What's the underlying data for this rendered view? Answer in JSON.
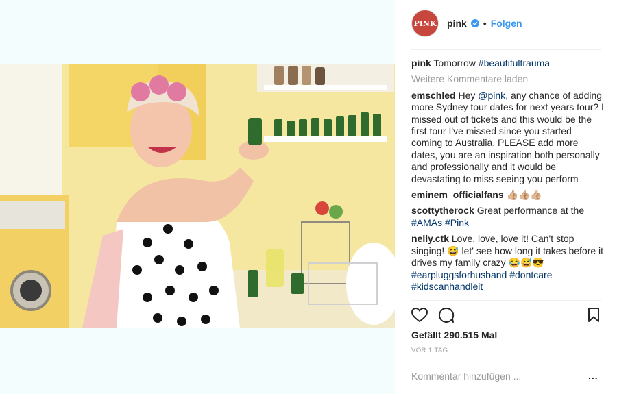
{
  "post": {
    "username": "pink",
    "avatar_text": "PINK",
    "follow_label": "Folgen",
    "separator": "•",
    "caption": {
      "user": "pink",
      "text": "Tomorrow",
      "hashtag": "#beautifultrauma"
    },
    "load_more": "Weitere Kommentare laden",
    "comments": [
      {
        "user": "emschled",
        "pre": "Hey",
        "mention": "@pink",
        "text": ", any chance of adding more Sydney tour dates for next years tour? I missed out of tickets and this would be the first tour I've missed since you started coming to Australia. PLEASE add more dates, you are an inspiration both personally and professionally and it would be devastating to miss seeing you perform"
      },
      {
        "user": "eminem_officialfans",
        "text": "👍🏼👍🏼👍🏼"
      },
      {
        "user": "scottytherock",
        "text": "Great performance at the",
        "hashtags": "#AMAs #Pink"
      },
      {
        "user": "nelly.ctk",
        "text": "Love, love, love it! Can't stop singing! 😅 let' see how long it takes before it drives my family crazy 😂😅😎",
        "hashtags": "#earpluggsforhusband #dontcare #kidscanhandleit"
      }
    ],
    "likes_text": "Gefällt 290.515 Mal",
    "date_text": "VOR 1 TAG",
    "add_comment_placeholder": "Kommentar hinzufügen ...",
    "more_label": "..."
  },
  "colors": {
    "link": "#003569",
    "follow": "#3897f0",
    "muted": "#999999",
    "verified": "#3897f0"
  }
}
